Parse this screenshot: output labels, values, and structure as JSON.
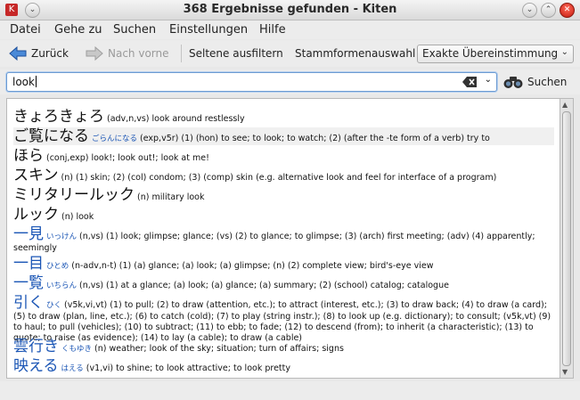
{
  "window": {
    "title": "368 Ergebnisse gefunden - Kiten",
    "app_icon": "K"
  },
  "menubar": [
    {
      "label": "Datei",
      "key": "datei"
    },
    {
      "label": "Gehe zu",
      "key": "gehe-zu"
    },
    {
      "label": "Suchen",
      "key": "suchen"
    },
    {
      "label": "Einstellungen",
      "key": "einstellungen"
    },
    {
      "label": "Hilfe",
      "key": "hilfe"
    }
  ],
  "toolbar": {
    "back_label": "Zurück",
    "forward_label": "Nach vorne",
    "rare_filter_label": "Seltene ausfiltern",
    "stem_label": "Stammformenauswahl",
    "match_mode": "Exakte Übereinstimmung"
  },
  "search": {
    "query": "look",
    "button_label": "Suchen"
  },
  "results": [
    {
      "word": "きょろきょろ",
      "reading": "",
      "definition": "(adv,n,vs) look around restlessly",
      "blue": false
    },
    {
      "word": "ご覧になる",
      "reading": "ごらんになる",
      "definition": "(exp,v5r) (1) (hon) to see; to look; to watch; (2) (after the -te form of a verb) try to",
      "blue": false
    },
    {
      "word": "ほら",
      "reading": "",
      "definition": "(conj,exp) look!; look out!; look at me!",
      "blue": false
    },
    {
      "word": "スキン",
      "reading": "",
      "definition": "(n) (1) skin; (2) (col) condom; (3) (comp) skin (e.g. alternative look and feel for interface of a program)",
      "blue": false
    },
    {
      "word": "ミリタリールック",
      "reading": "",
      "definition": "(n) military look",
      "blue": false
    },
    {
      "word": "ルック",
      "reading": "",
      "definition": "(n) look",
      "blue": false
    },
    {
      "word": "一見",
      "reading": "いっけん",
      "definition": "(n,vs) (1) look; glimpse; glance; (vs) (2) to glance; to glimpse; (3) (arch) first meeting; (adv) (4) apparently; seemingly",
      "blue": true
    },
    {
      "word": "一目",
      "reading": "ひとめ",
      "definition": "(n-adv,n-t) (1) (a) glance; (a) look; (a) glimpse; (n) (2) complete view; bird's-eye view",
      "blue": true
    },
    {
      "word": "一覧",
      "reading": "いちらん",
      "definition": "(n,vs) (1) at a glance; (a) look; (a) glance; (a) summary; (2) (school) catalog; catalogue",
      "blue": true
    },
    {
      "word": "引く",
      "reading": "ひく",
      "definition": "(v5k,vi,vt) (1) to pull; (2) to draw (attention, etc.); to attract (interest, etc.); (3) to draw back; (4) to draw (a card); (5) to draw (plan, line, etc.); (6) to catch (cold); (7) to play (string instr.); (8) to look up (e.g. dictionary); to consult; (v5k,vt) (9) to haul; to pull (vehicles); (10) to subtract; (11) to ebb; to fade; (12) to descend (from); to inherit (a characteristic); (13) to quote; to raise (as evidence); (14) to lay (a cable); to draw (a cable)",
      "blue": true
    },
    {
      "word": "雲行き",
      "reading": "くもゆき",
      "definition": "(n) weather; look of the sky; situation; turn of affairs; signs",
      "blue": true
    },
    {
      "word": "映える",
      "reading": "はえる",
      "definition": "(v1,vi) to shine; to look attractive; to look pretty",
      "blue": true
    }
  ],
  "colors": {
    "link_blue": "#1a55b5",
    "close_red": "#c41a0e"
  }
}
